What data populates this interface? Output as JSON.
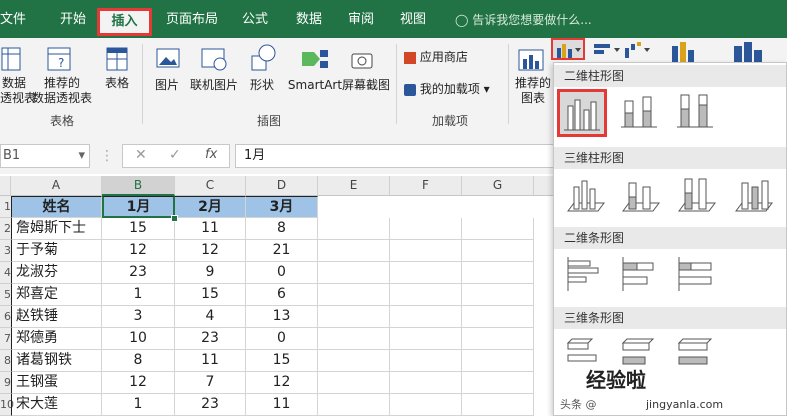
{
  "tabs": [
    {
      "label": "文件",
      "active": false
    },
    {
      "label": "开始",
      "active": false
    },
    {
      "label": "插入",
      "active": true
    },
    {
      "label": "页面布局",
      "active": false
    },
    {
      "label": "公式",
      "active": false
    },
    {
      "label": "数据",
      "active": false
    },
    {
      "label": "审阅",
      "active": false
    },
    {
      "label": "视图",
      "active": false
    }
  ],
  "tell_me": "告诉我您想要做什么...",
  "ribbon": {
    "pivot_table": "数据\n透视表",
    "recommended_pivot": "推荐的\n数据透视表",
    "table": "表格",
    "group_tables": "表格",
    "picture": "图片",
    "online_picture": "联机图片",
    "shapes": "形状",
    "smartart": "SmartArt",
    "screenshot": "屏幕截图",
    "group_illustrations": "插图",
    "store": "应用商店",
    "my_addins": "我的加载项",
    "group_addins": "加载项",
    "recommended_charts": "推荐的\n图表"
  },
  "formula_bar": {
    "name_box": "B1",
    "content": "1月"
  },
  "columns": [
    "A",
    "B",
    "C",
    "D",
    "E",
    "F",
    "G"
  ],
  "header_row": [
    "姓名",
    "1月",
    "2月",
    "3月"
  ],
  "rows": [
    {
      "num": "2",
      "name": "詹姆斯下士",
      "b": "15",
      "c": "11",
      "d": "8"
    },
    {
      "num": "3",
      "name": "于予菊",
      "b": "12",
      "c": "12",
      "d": "21"
    },
    {
      "num": "4",
      "name": "龙淑芬",
      "b": "23",
      "c": "9",
      "d": "0"
    },
    {
      "num": "5",
      "name": "郑喜定",
      "b": "1",
      "c": "15",
      "d": "6"
    },
    {
      "num": "6",
      "name": "赵铁锤",
      "b": "3",
      "c": "4",
      "d": "13"
    },
    {
      "num": "7",
      "name": "郑德勇",
      "b": "10",
      "c": "23",
      "d": "0"
    },
    {
      "num": "8",
      "name": "诸葛钢铁",
      "b": "8",
      "c": "11",
      "d": "15"
    },
    {
      "num": "9",
      "name": "王钢蛋",
      "b": "12",
      "c": "7",
      "d": "12"
    },
    {
      "num": "10",
      "name": "宋大莲",
      "b": "1",
      "c": "23",
      "d": "11"
    }
  ],
  "chart_menu": {
    "section_2d_column": "二维柱形图",
    "section_3d_column": "三维柱形图",
    "section_2d_bar": "二维条形图",
    "section_3d_bar": "三维条形图"
  },
  "watermark": "经验啦",
  "watermark_sub": "jingyanla.com",
  "watermark_prefix": "头条 @",
  "accent": "#217346",
  "highlight": "#e53935",
  "header_fill": "#9ec3e6"
}
